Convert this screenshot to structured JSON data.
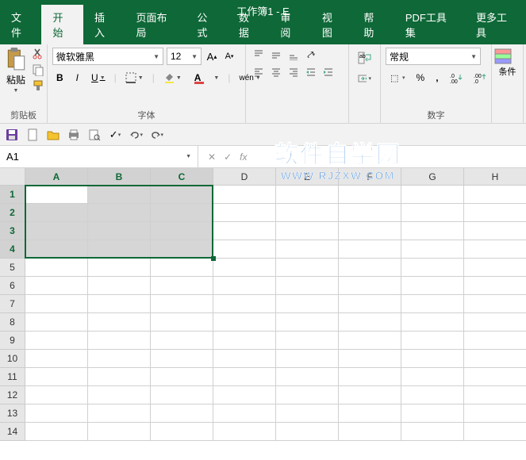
{
  "title": "工作簿1 - E",
  "tabs": [
    "文件",
    "开始",
    "插入",
    "页面布局",
    "公式",
    "数据",
    "审阅",
    "视图",
    "帮助",
    "PDF工具集",
    "更多工具"
  ],
  "active_tab": 1,
  "ribbon": {
    "clipboard": {
      "label": "剪贴板",
      "paste": "粘贴"
    },
    "font": {
      "label": "字体",
      "name": "微软雅黑",
      "size": "12",
      "bold": "B",
      "italic": "I",
      "underline": "U",
      "wen": "wén"
    },
    "align": {
      "label": ""
    },
    "number": {
      "label": "数字",
      "format": "常规",
      "percent": "%",
      "comma": ","
    }
  },
  "cond_label": "条件",
  "namebox": "A1",
  "formula": "",
  "columns": [
    "A",
    "B",
    "C",
    "D",
    "E",
    "F",
    "G",
    "H"
  ],
  "rows": [
    "1",
    "2",
    "3",
    "4",
    "5",
    "6",
    "7",
    "8",
    "9",
    "10",
    "11",
    "12",
    "13",
    "14"
  ],
  "selection": {
    "r1": 0,
    "c1": 0,
    "r2": 3,
    "c2": 2
  },
  "watermark": {
    "main": "软件自学网",
    "sub": "WWW.RJZXW.COM"
  }
}
